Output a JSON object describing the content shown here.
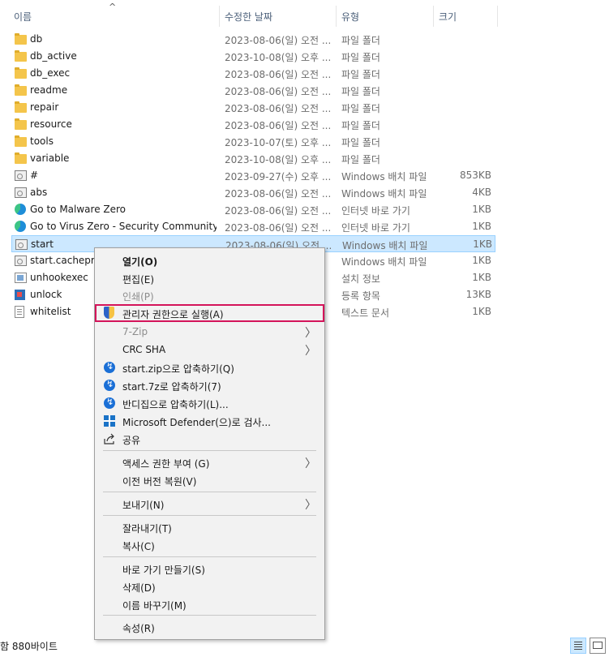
{
  "header": {
    "col_name": "이름",
    "col_date": "수정한 날짜",
    "col_type": "유형",
    "col_size": "크기",
    "sort_indicator": "^"
  },
  "files": [
    {
      "name": "db",
      "date": "2023-08-06(일) 오전 ...",
      "type": "파일 폴더",
      "size": "",
      "icon": "folder-icon"
    },
    {
      "name": "db_active",
      "date": "2023-10-08(일) 오후 ...",
      "type": "파일 폴더",
      "size": "",
      "icon": "folder-icon"
    },
    {
      "name": "db_exec",
      "date": "2023-08-06(일) 오전 ...",
      "type": "파일 폴더",
      "size": "",
      "icon": "folder-icon"
    },
    {
      "name": "readme",
      "date": "2023-08-06(일) 오전 ...",
      "type": "파일 폴더",
      "size": "",
      "icon": "folder-icon"
    },
    {
      "name": "repair",
      "date": "2023-08-06(일) 오전 ...",
      "type": "파일 폴더",
      "size": "",
      "icon": "folder-icon"
    },
    {
      "name": "resource",
      "date": "2023-08-06(일) 오전 ...",
      "type": "파일 폴더",
      "size": "",
      "icon": "folder-icon"
    },
    {
      "name": "tools",
      "date": "2023-10-07(토) 오후 ...",
      "type": "파일 폴더",
      "size": "",
      "icon": "folder-icon"
    },
    {
      "name": "variable",
      "date": "2023-10-08(일) 오후 ...",
      "type": "파일 폴더",
      "size": "",
      "icon": "folder-icon"
    },
    {
      "name": "#",
      "date": "2023-09-27(수) 오후 ...",
      "type": "Windows 배치 파일",
      "size": "853KB",
      "icon": "batch-file-icon"
    },
    {
      "name": "abs",
      "date": "2023-08-06(일) 오전 ...",
      "type": "Windows 배치 파일",
      "size": "4KB",
      "icon": "batch-file-icon"
    },
    {
      "name": "Go to Malware Zero",
      "date": "2023-08-06(일) 오전 ...",
      "type": "인터넷 바로 가기",
      "size": "1KB",
      "icon": "edge-shortcut-icon"
    },
    {
      "name": "Go to Virus Zero - Security Community",
      "date": "2023-08-06(일) 오전 ...",
      "type": "인터넷 바로 가기",
      "size": "1KB",
      "icon": "edge-shortcut-icon"
    },
    {
      "name": "start",
      "date": "2023-08-06(일) 오전 ...",
      "type": "Windows 배치 파일",
      "size": "1KB",
      "icon": "batch-file-icon",
      "selected": true
    },
    {
      "name": "start.cacheprot",
      "date": "",
      "type": "Windows 배치 파일",
      "size": "1KB",
      "icon": "batch-file-icon"
    },
    {
      "name": "unhookexec",
      "date": "",
      "type": "설치 정보",
      "size": "1KB",
      "icon": "setup-info-icon"
    },
    {
      "name": "unlock",
      "date": "",
      "type": "등록 항목",
      "size": "13KB",
      "icon": "registry-icon"
    },
    {
      "name": "whitelist",
      "date": "",
      "type": "텍스트 문서",
      "size": "1KB",
      "icon": "text-document-icon"
    }
  ],
  "context_menu": {
    "open": "열기(O)",
    "edit": "편집(E)",
    "print": "인쇄(P)",
    "run_as_admin": "관리자 권한으로 실행(A)",
    "seven_zip": "7-Zip",
    "crc_sha": "CRC SHA",
    "zip_compress": "start.zip으로 압축하기(Q)",
    "sevenz_compress": "start.7z로 압축하기(7)",
    "bandizip_compress": "반디집으로 압축하기(L)...",
    "defender_scan": "Microsoft Defender(으)로 검사...",
    "share": "공유",
    "give_access": "액세스 권한 부여 (G)",
    "restore_versions": "이전 버전 복원(V)",
    "send_to": "보내기(N)",
    "cut": "잘라내기(T)",
    "copy": "복사(C)",
    "create_shortcut": "바로 가기 만들기(S)",
    "delete": "삭제(D)",
    "rename": "이름 바꾸기(M)",
    "properties": "속성(R)",
    "submenu_arrow": "〉"
  },
  "status_bar": {
    "text": "함 880바이트"
  },
  "colors": {
    "selection_bg": "#cce8ff",
    "highlight_border": "#d4145a",
    "menu_bg": "#f2f2f2"
  }
}
